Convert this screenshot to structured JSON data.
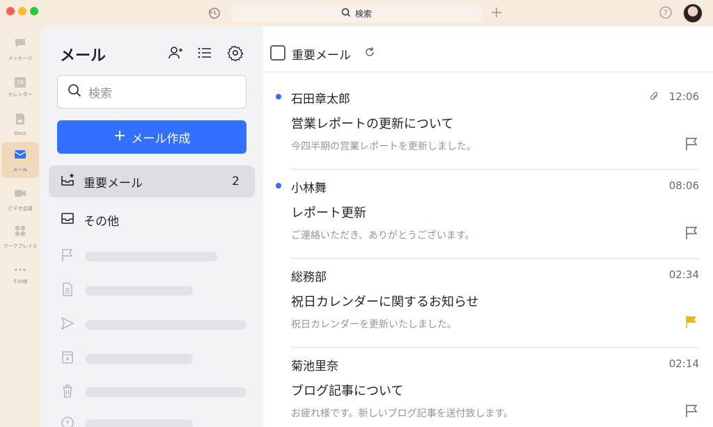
{
  "titlebar": {
    "search_label": "検索",
    "icons": [
      "history-icon",
      "search-icon",
      "plus-icon",
      "help-icon",
      "avatar"
    ]
  },
  "rail": {
    "items": [
      {
        "label": "メッセージ",
        "icon": "chat-icon",
        "active": false
      },
      {
        "label": "カレンダー",
        "icon": "calendar-icon",
        "day": "26",
        "active": false
      },
      {
        "label": "Docs",
        "icon": "docs-icon",
        "active": false
      },
      {
        "label": "メール",
        "icon": "mail-icon",
        "active": true
      },
      {
        "label": "ビデオ会議",
        "icon": "video-icon",
        "active": false
      },
      {
        "label": "ワークプレイス",
        "icon": "workplace-icon",
        "active": false
      },
      {
        "label": "その他",
        "icon": "more-icon",
        "active": false
      }
    ]
  },
  "sidebar": {
    "title": "メール",
    "search_placeholder": "検索",
    "compose_label": "メール作成",
    "folders": [
      {
        "label": "重要メール",
        "count": "2",
        "active": true
      },
      {
        "label": "その他",
        "count": "",
        "active": false
      }
    ]
  },
  "mail_list": {
    "header_title": "重要メール",
    "items": [
      {
        "sender": "石田章太郎",
        "time": "12:06",
        "subject": "営業レポートの更新について",
        "preview": "今四半期の営業レポートを更新しました。",
        "unread": true,
        "attachment": true,
        "flagged": false
      },
      {
        "sender": "小林舞",
        "time": "08:06",
        "subject": "レポート更新",
        "preview": "ご連絡いただき、ありがとうございます。",
        "unread": true,
        "attachment": false,
        "flagged": false
      },
      {
        "sender": "総務部",
        "time": "02:34",
        "subject": "祝日カレンダーに関するお知らせ",
        "preview": "祝日カレンダーを更新いたしました。",
        "unread": false,
        "attachment": false,
        "flagged": true
      },
      {
        "sender": "菊池里奈",
        "time": "02:14",
        "subject": "ブログ記事について",
        "preview": "お疲れ様です。新しいブログ記事を送付致します。",
        "unread": false,
        "attachment": false,
        "flagged": false
      }
    ]
  },
  "colors": {
    "accent": "#3370ff",
    "flag_active": "#f5b60a",
    "sidebar_bg": "#f2f3f5",
    "app_bg": "#f6ecdf"
  }
}
